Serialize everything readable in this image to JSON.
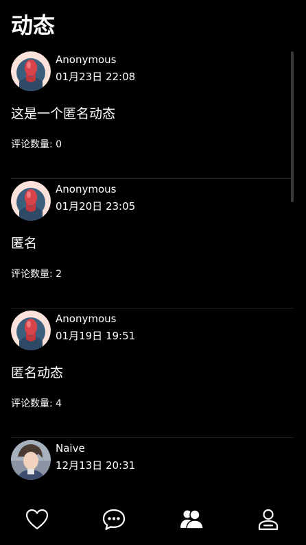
{
  "header": {
    "title": "动态"
  },
  "posts": [
    {
      "author": "Anonymous",
      "time": "01月23日 22:08",
      "content": "这是一个匿名动态",
      "comments": "评论数量: 0",
      "avatar": "anonymous-avatar"
    },
    {
      "author": "Anonymous",
      "time": "01月20日 23:05",
      "content": "匿名",
      "comments": "评论数量: 2",
      "avatar": "anonymous-avatar"
    },
    {
      "author": "Anonymous",
      "time": "01月19日 19:51",
      "content": "匿名动态",
      "comments": "评论数量: 4",
      "avatar": "anonymous-avatar"
    },
    {
      "author": "Naive",
      "time": "12月13日 20:31",
      "content": "",
      "comments": "",
      "avatar": "user-photo-avatar"
    }
  ],
  "tabbar": {
    "tabs": [
      {
        "icon": "heart-icon"
      },
      {
        "icon": "chat-bubble-icon"
      },
      {
        "icon": "users-icon"
      },
      {
        "icon": "profile-icon"
      }
    ]
  },
  "colors": {
    "background": "#000000",
    "text": "#ffffff",
    "divider": "#1f1f1f",
    "scrollbar": "#3a3a3a"
  }
}
